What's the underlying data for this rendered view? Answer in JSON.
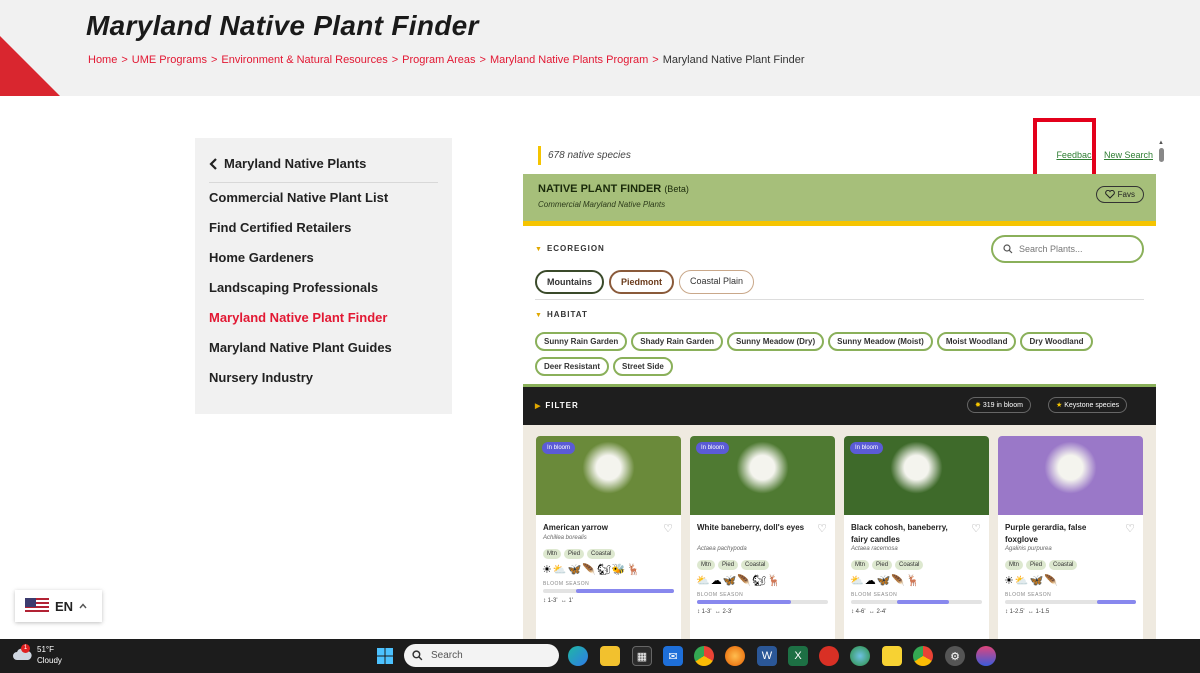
{
  "page": {
    "title": "Maryland Native Plant Finder",
    "breadcrumb": [
      "Home",
      "UME Programs",
      "Environment & Natural Resources",
      "Program Areas",
      "Maryland Native Plants Program"
    ],
    "breadcrumb_current": "Maryland Native Plant Finder"
  },
  "sidenav": {
    "back_label": "Maryland Native Plants",
    "items": [
      {
        "label": "Commercial Native Plant List",
        "active": false
      },
      {
        "label": "Find Certified Retailers",
        "active": false
      },
      {
        "label": "Home Gardeners",
        "active": false
      },
      {
        "label": "Landscaping Professionals",
        "active": false
      },
      {
        "label": "Maryland Native Plant Finder",
        "active": true
      },
      {
        "label": "Maryland Native Plant Guides",
        "active": false
      },
      {
        "label": "Nursery Industry",
        "active": false
      }
    ]
  },
  "finder": {
    "count": "678 native species",
    "feedback": "Feedback",
    "new_search": "New Search",
    "banner_title": "NATIVE PLANT FINDER",
    "banner_beta": "(Beta)",
    "banner_sub": "Commercial Maryland Native Plants",
    "favs": "Favs",
    "ecoregion_label": "ECOREGION",
    "search_placeholder": "Search Plants...",
    "ecoregions": [
      "Mountains",
      "Piedmont",
      "Coastal Plain"
    ],
    "habitat_label": "HABITAT",
    "habitats": [
      "Sunny Rain Garden",
      "Shady Rain Garden",
      "Sunny Meadow (Dry)",
      "Sunny Meadow (Moist)",
      "Moist Woodland",
      "Dry Woodland",
      "Deer Resistant",
      "Street Side"
    ],
    "filter_label": "FILTER",
    "in_bloom_count": "319",
    "in_bloom_label": "in bloom",
    "keystone_label": "Keystone species"
  },
  "cards": [
    {
      "badge": "In bloom",
      "name": "American yarrow",
      "sci": "Achillea borealis",
      "tags": [
        "Mtn",
        "Pied",
        "Coastal"
      ],
      "icons": "☀⛅🦋🪶🐿🐝🦌",
      "bloom_label": "BLOOM SEASON",
      "bloom_start": 0.25,
      "bloom_end": 1.0,
      "size_h": "1-3'",
      "size_w": "1'",
      "img_color": "#6a8a3a"
    },
    {
      "badge": "In bloom",
      "name": "White baneberry, doll's eyes",
      "sci": "Actaea pachypoda",
      "tags": [
        "Mtn",
        "Pied",
        "Coastal"
      ],
      "icons": "⛅☁🦋🪶🐿🦌",
      "bloom_label": "BLOOM SEASON",
      "bloom_start": 0.0,
      "bloom_end": 0.72,
      "size_h": "1-3'",
      "size_w": "2-3'",
      "img_color": "#4f7a32"
    },
    {
      "badge": "In bloom",
      "name": "Black cohosh, baneberry, fairy candles",
      "sci": "Actaea racemosa",
      "tags": [
        "Mtn",
        "Pied",
        "Coastal"
      ],
      "icons": "⛅☁🦋🪶🦌",
      "bloom_label": "BLOOM SEASON",
      "bloom_start": 0.35,
      "bloom_end": 0.75,
      "size_h": "4-6'",
      "size_w": "2-4'",
      "img_color": "#3e6a2a"
    },
    {
      "badge": "",
      "name": "Purple gerardia, false foxglove",
      "sci": "Agalinis purpurea",
      "tags": [
        "Mtn",
        "Pied",
        "Coastal"
      ],
      "icons": "☀⛅🦋🪶",
      "bloom_label": "BLOOM SEASON",
      "bloom_start": 0.7,
      "bloom_end": 1.0,
      "size_h": "1-2.5'",
      "size_w": "1-1.5",
      "img_color": "#9a78c8"
    }
  ],
  "lang": {
    "code": "EN"
  },
  "taskbar": {
    "temp": "51°F",
    "condition": "Cloudy",
    "notif": "1",
    "search": "Search"
  },
  "colors": {
    "accent_red": "#e21833",
    "banner_green": "#a6bf7a",
    "gold": "#f5c400"
  }
}
